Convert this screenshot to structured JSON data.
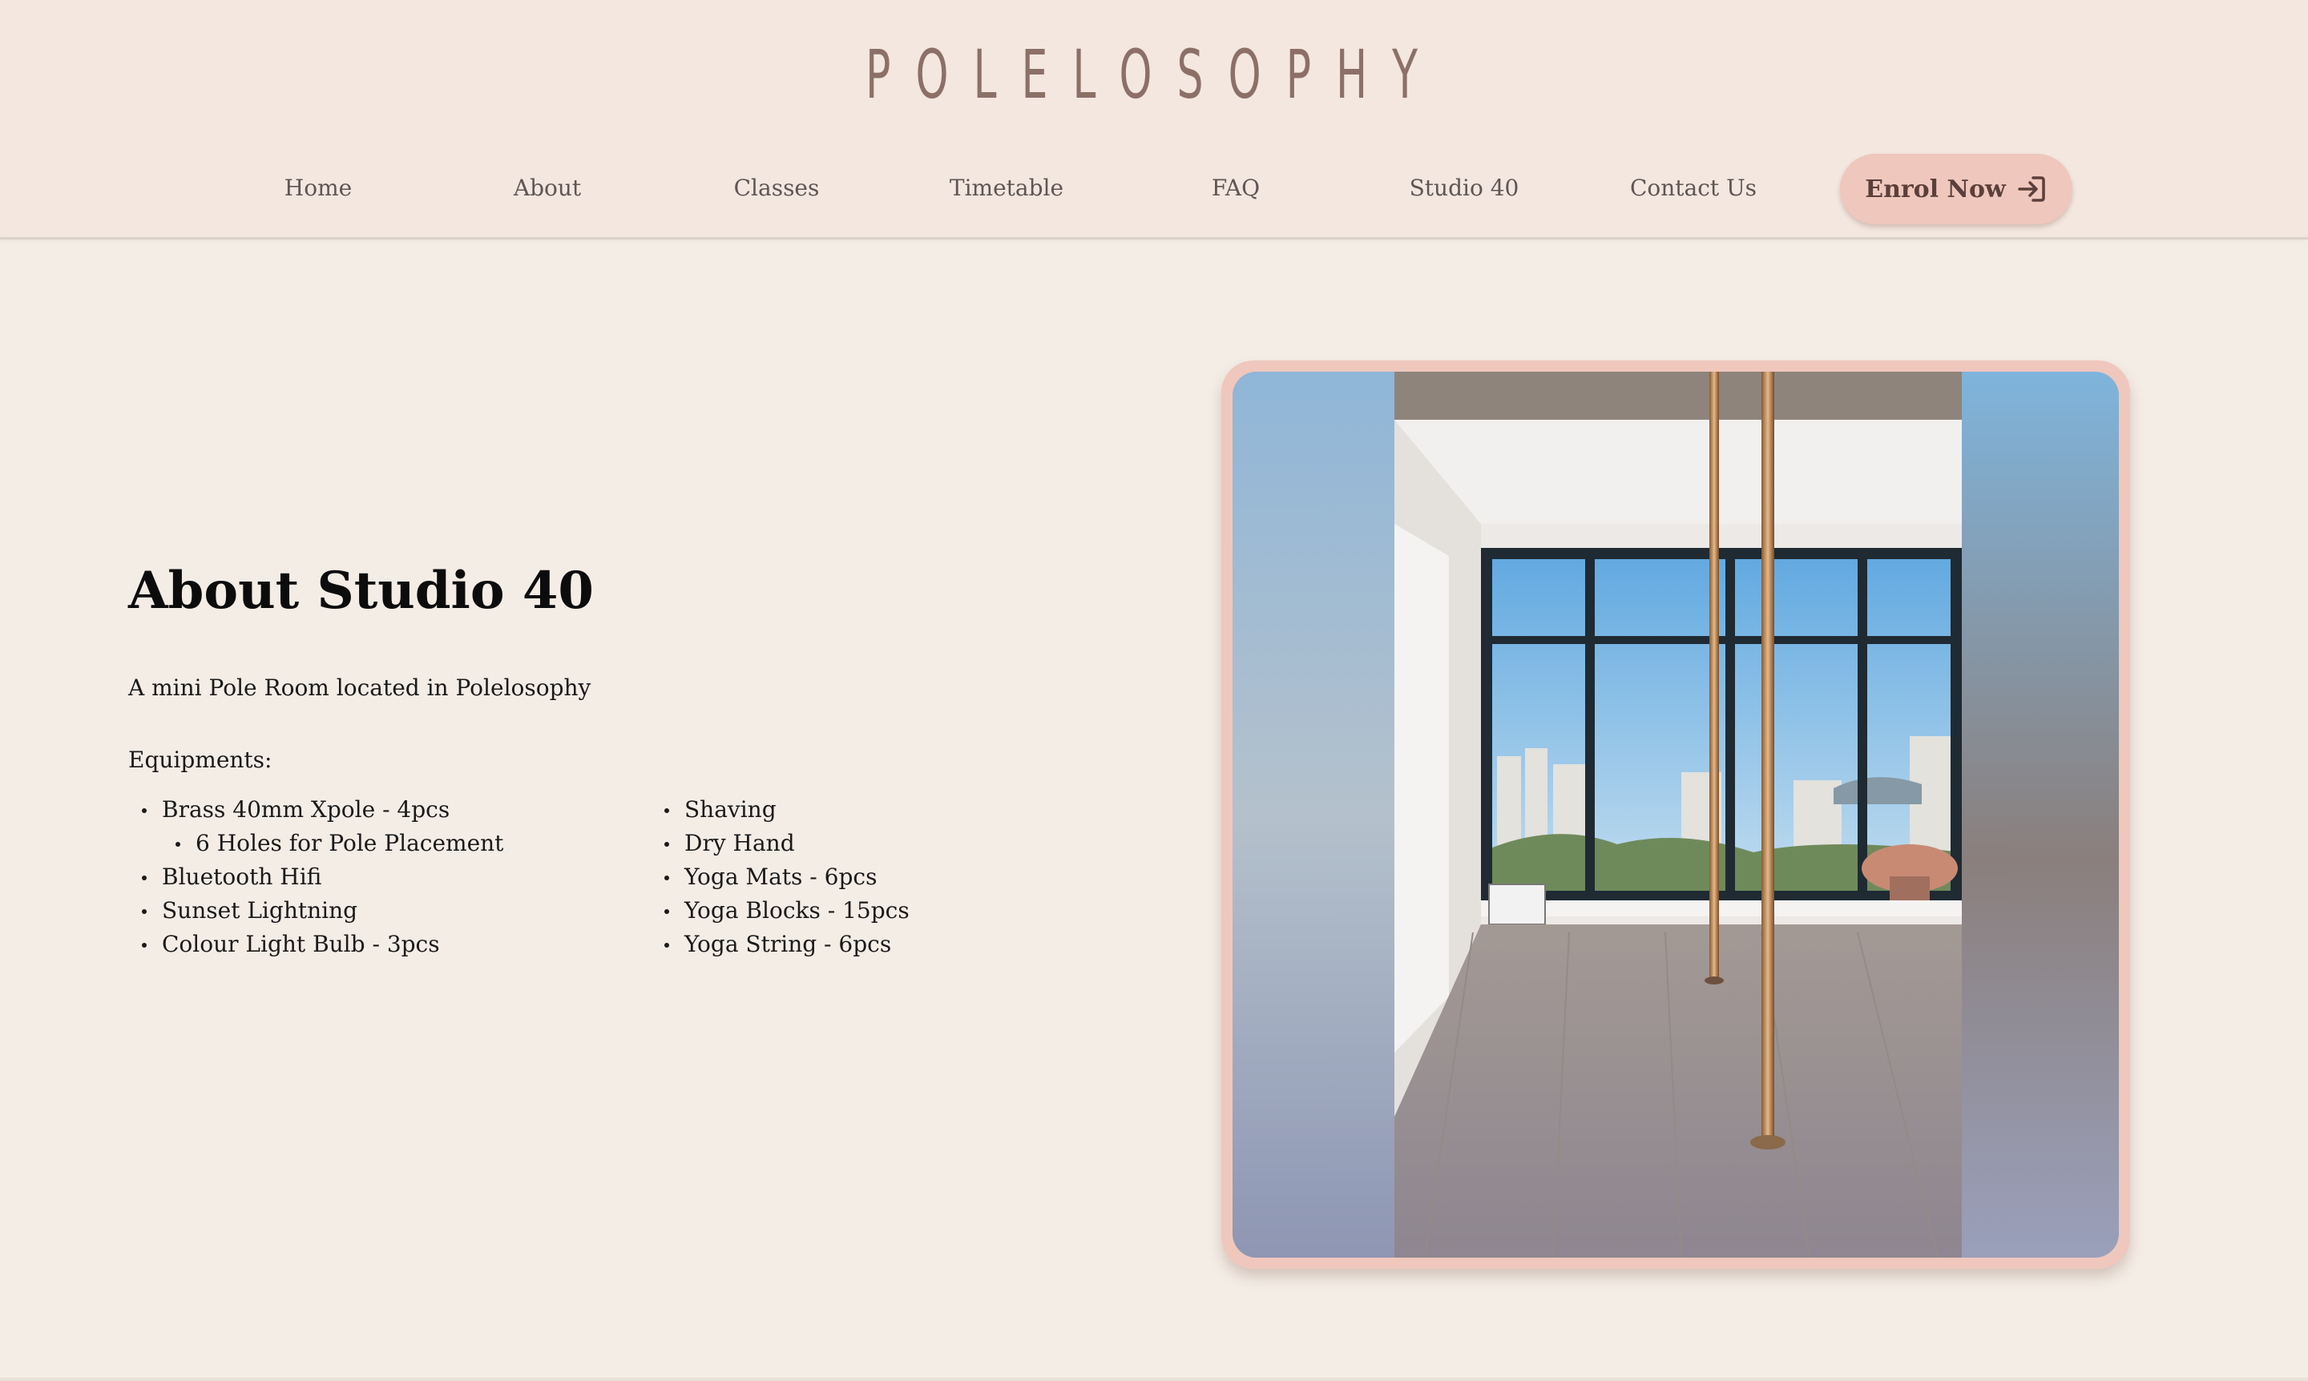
{
  "header": {
    "logo": "POLELOSOPHY",
    "nav": [
      {
        "label": "Home"
      },
      {
        "label": "About"
      },
      {
        "label": "Classes"
      },
      {
        "label": "Timetable"
      },
      {
        "label": "FAQ"
      },
      {
        "label": "Studio 40"
      },
      {
        "label": "Contact Us"
      }
    ],
    "enrol_button": {
      "label": "Enrol Now",
      "icon": "sign-in-arrow-icon"
    }
  },
  "main": {
    "title": "About Studio 40",
    "subtitle": "A mini Pole Room located in Polelosophy",
    "equipment_heading": "Equipments:",
    "equipment_left": [
      {
        "label": "Brass 40mm Xpole - 4pcs"
      },
      {
        "label": "6 Holes for Pole Placement"
      },
      {
        "label": "Bluetooth Hifi"
      },
      {
        "label": "Sunset Lightning"
      },
      {
        "label": "Colour Light Bulb - 3pcs"
      }
    ],
    "equipment_right": [
      {
        "label": "Shaving"
      },
      {
        "label": "Dry Hand"
      },
      {
        "label": "Yoga Mats - 6pcs"
      },
      {
        "label": "Yoga Blocks - 15pcs"
      },
      {
        "label": "Yoga String - 6pcs"
      }
    ]
  },
  "colors": {
    "background": "#f4ede5",
    "header_bg": "#f3e7df",
    "accent_pink": "#efc7bd",
    "logo_color": "#8c7068",
    "nav_text": "#5e5654"
  }
}
